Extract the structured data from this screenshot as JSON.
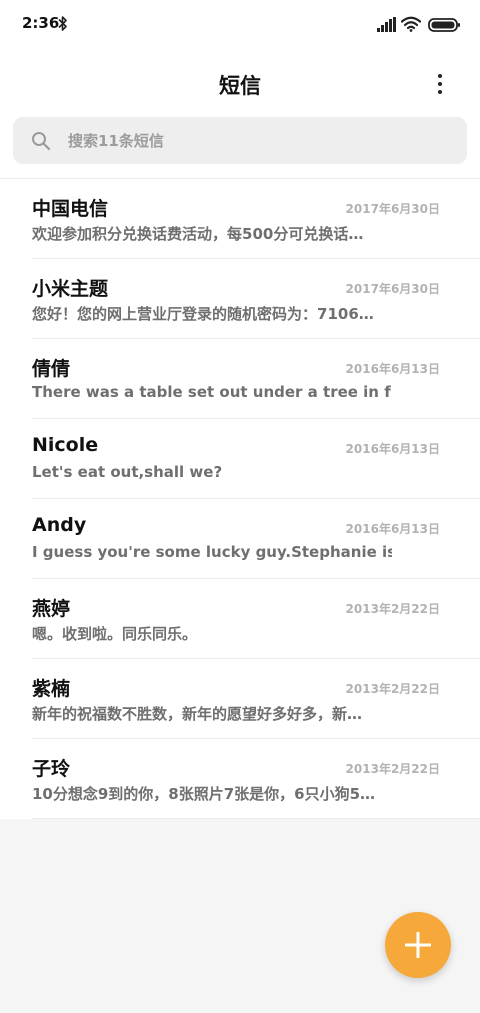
{
  "status_bar": {
    "time": "2:36",
    "icons": [
      "bluetooth-icon",
      "signal-icon",
      "wifi-icon",
      "battery-icon"
    ]
  },
  "header": {
    "title": "短信",
    "menu_icon": "more-vertical-icon"
  },
  "search": {
    "placeholder": "搜索11条短信",
    "icon": "search-icon"
  },
  "messages": [
    {
      "sender": "中国电信",
      "date": "2017年6月30日",
      "preview": "欢迎参加积分兑换话费活动，每500分可兑换话…"
    },
    {
      "sender": "小米主题",
      "date": "2017年6月30日",
      "preview": "您好！您的网上营业厅登录的随机密码为：7106…"
    },
    {
      "sender": "倩倩",
      "date": "2016年6月13日",
      "preview": "There was a table set out under a tree in front of…"
    },
    {
      "sender": "Nicole",
      "date": "2016年6月13日",
      "preview": "Let's eat out,shall we?"
    },
    {
      "sender": "Andy",
      "date": "2016年6月13日",
      "preview": "I guess you're some lucky guy.Stephanie is a nic…"
    },
    {
      "sender": "燕婷",
      "date": "2013年2月22日",
      "preview": "嗯。收到啦。同乐同乐。"
    },
    {
      "sender": "紫楠",
      "date": "2013年2月22日",
      "preview": "新年的祝福数不胜数，新年的愿望好多好多，新…"
    },
    {
      "sender": "子玲",
      "date": "2013年2月22日",
      "preview": "10分想念9到的你，8张照片7张是你，6只小狗5…"
    }
  ],
  "fab": {
    "icon": "plus-icon"
  },
  "colors": {
    "accent": "#f6a83b",
    "background": "#f5f5f5",
    "date_text": "#b2b2b2",
    "preview_text": "#6f6f6f"
  }
}
